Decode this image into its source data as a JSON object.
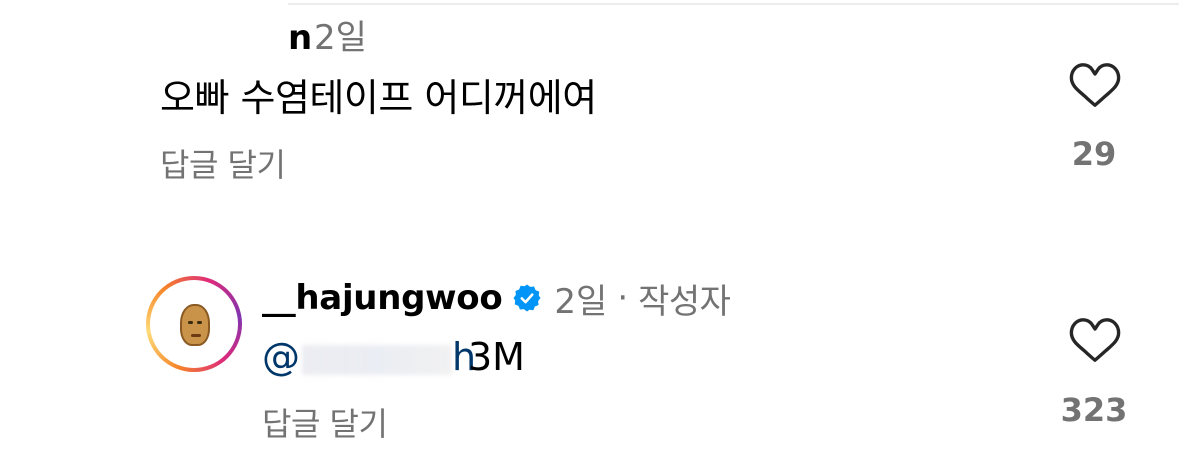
{
  "comment": {
    "username_partial": "n",
    "time": "2일",
    "text": "오빠 수염테이프 어디꺼에여",
    "reply_label": "답글 달기",
    "like_count": "29"
  },
  "reply": {
    "username": "__hajungwoo",
    "verified": true,
    "time": "2일",
    "separator": "·",
    "author_badge": "작성자",
    "mention_prefix": "@",
    "mention_suffix": "h",
    "text": "3M",
    "reply_label": "답글 달기",
    "like_count": "323"
  },
  "icons": {
    "like": "heart-outline-icon",
    "verified": "verified-badge-icon"
  },
  "colors": {
    "secondary_text": "#737373",
    "mention": "#00376b",
    "verified_blue": "#0095f6"
  }
}
